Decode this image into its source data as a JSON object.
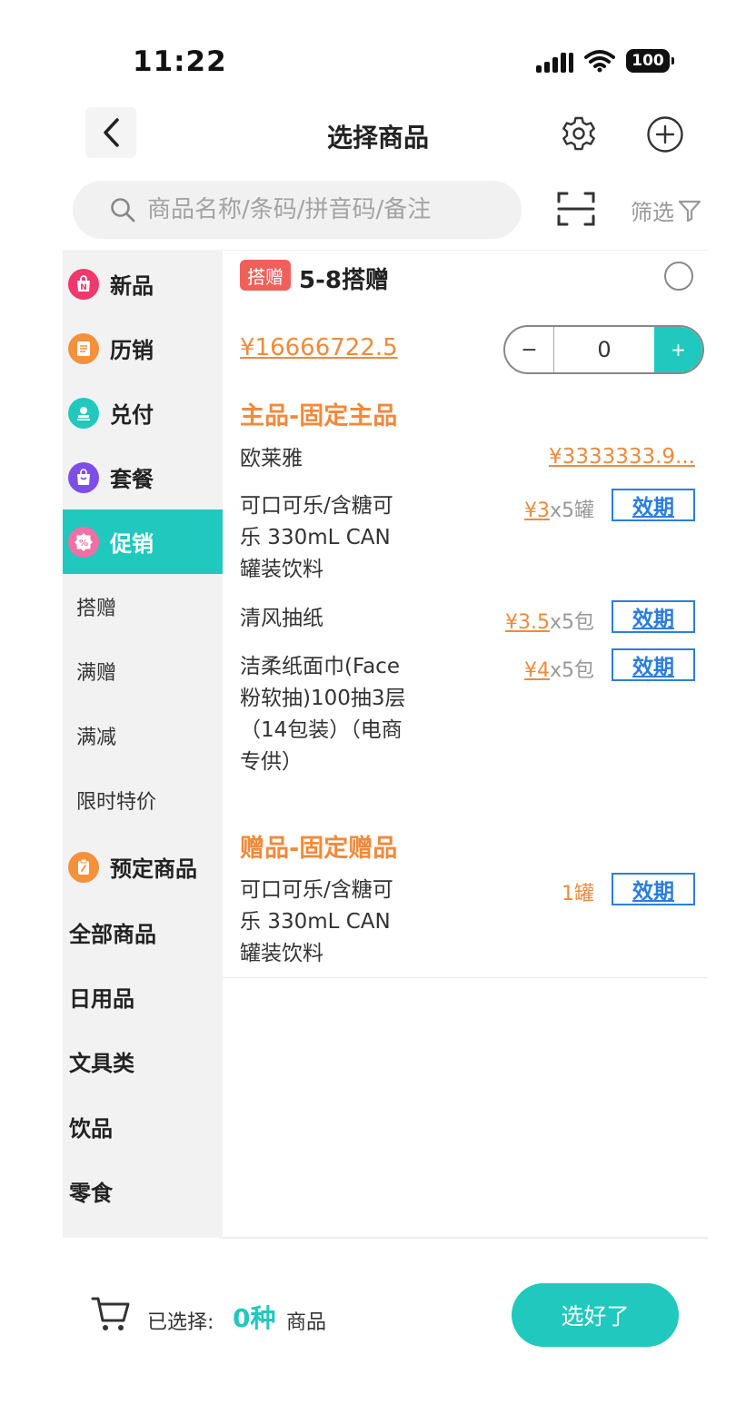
{
  "status_bar": {
    "time": "11:22",
    "battery": "100"
  },
  "header": {
    "title": "选择商品"
  },
  "search": {
    "placeholder": "商品名称/条码/拼音码/备注",
    "filter_label": "筛选"
  },
  "sidebar": {
    "categories": [
      {
        "label": "新品",
        "icon": "new-product-icon",
        "color": "#f0386c"
      },
      {
        "label": "历销",
        "icon": "sales-history-icon",
        "color": "#f5913a"
      },
      {
        "label": "兑付",
        "icon": "redeem-icon",
        "color": "#21c8bd"
      },
      {
        "label": "套餐",
        "icon": "package-icon",
        "color": "#7e4fe6"
      },
      {
        "label": "促销",
        "icon": "promotion-icon",
        "color": "#f06fa4",
        "active": true
      },
      {
        "label": "搭赠",
        "sub": true
      },
      {
        "label": "满赠",
        "sub": true
      },
      {
        "label": "满减",
        "sub": true
      },
      {
        "label": "限时特价",
        "sub": true
      },
      {
        "label": "预定商品",
        "icon": "preorder-icon",
        "color": "#f5913a"
      },
      {
        "label": "全部商品"
      },
      {
        "label": "日用品"
      },
      {
        "label": "文具类"
      },
      {
        "label": "饮品"
      },
      {
        "label": "零食"
      }
    ]
  },
  "promo": {
    "tag": "搭赠",
    "name": "5-8搭赠",
    "price": "¥16666722.5",
    "quantity": "0",
    "minus_label": "−",
    "plus_label": "+",
    "main_section_title": "主品-固定主品",
    "main_brand": {
      "name": "欧莱雅",
      "price": "¥3333333.9..."
    },
    "main_items": [
      {
        "name": "可口可乐/含糖可乐 330mL CAN 罐装饮料",
        "price": "¥3",
        "qty": "x5罐",
        "expiry": "效期"
      },
      {
        "name": "清风抽纸",
        "price": "¥3.5",
        "qty": "x5包",
        "expiry": "效期"
      },
      {
        "name": "洁柔纸面巾(Face粉软抽)100抽3层（14包装）（电商专供）",
        "price": "¥4",
        "qty": "x5包",
        "expiry": "效期"
      }
    ],
    "gift_section_title": "赠品-固定赠品",
    "gift_items": [
      {
        "name": "可口可乐/含糖可乐 330mL CAN 罐装饮料",
        "qty": "1罐",
        "expiry": "效期"
      }
    ]
  },
  "bottom": {
    "selected_label": "已选择:",
    "selected_count": "0种",
    "selected_unit": "商品",
    "confirm_label": "选好了"
  },
  "colors": {
    "accent": "#21c8bd",
    "price": "#f08a3c",
    "link": "#2a7de1",
    "tag": "#f0605a"
  }
}
